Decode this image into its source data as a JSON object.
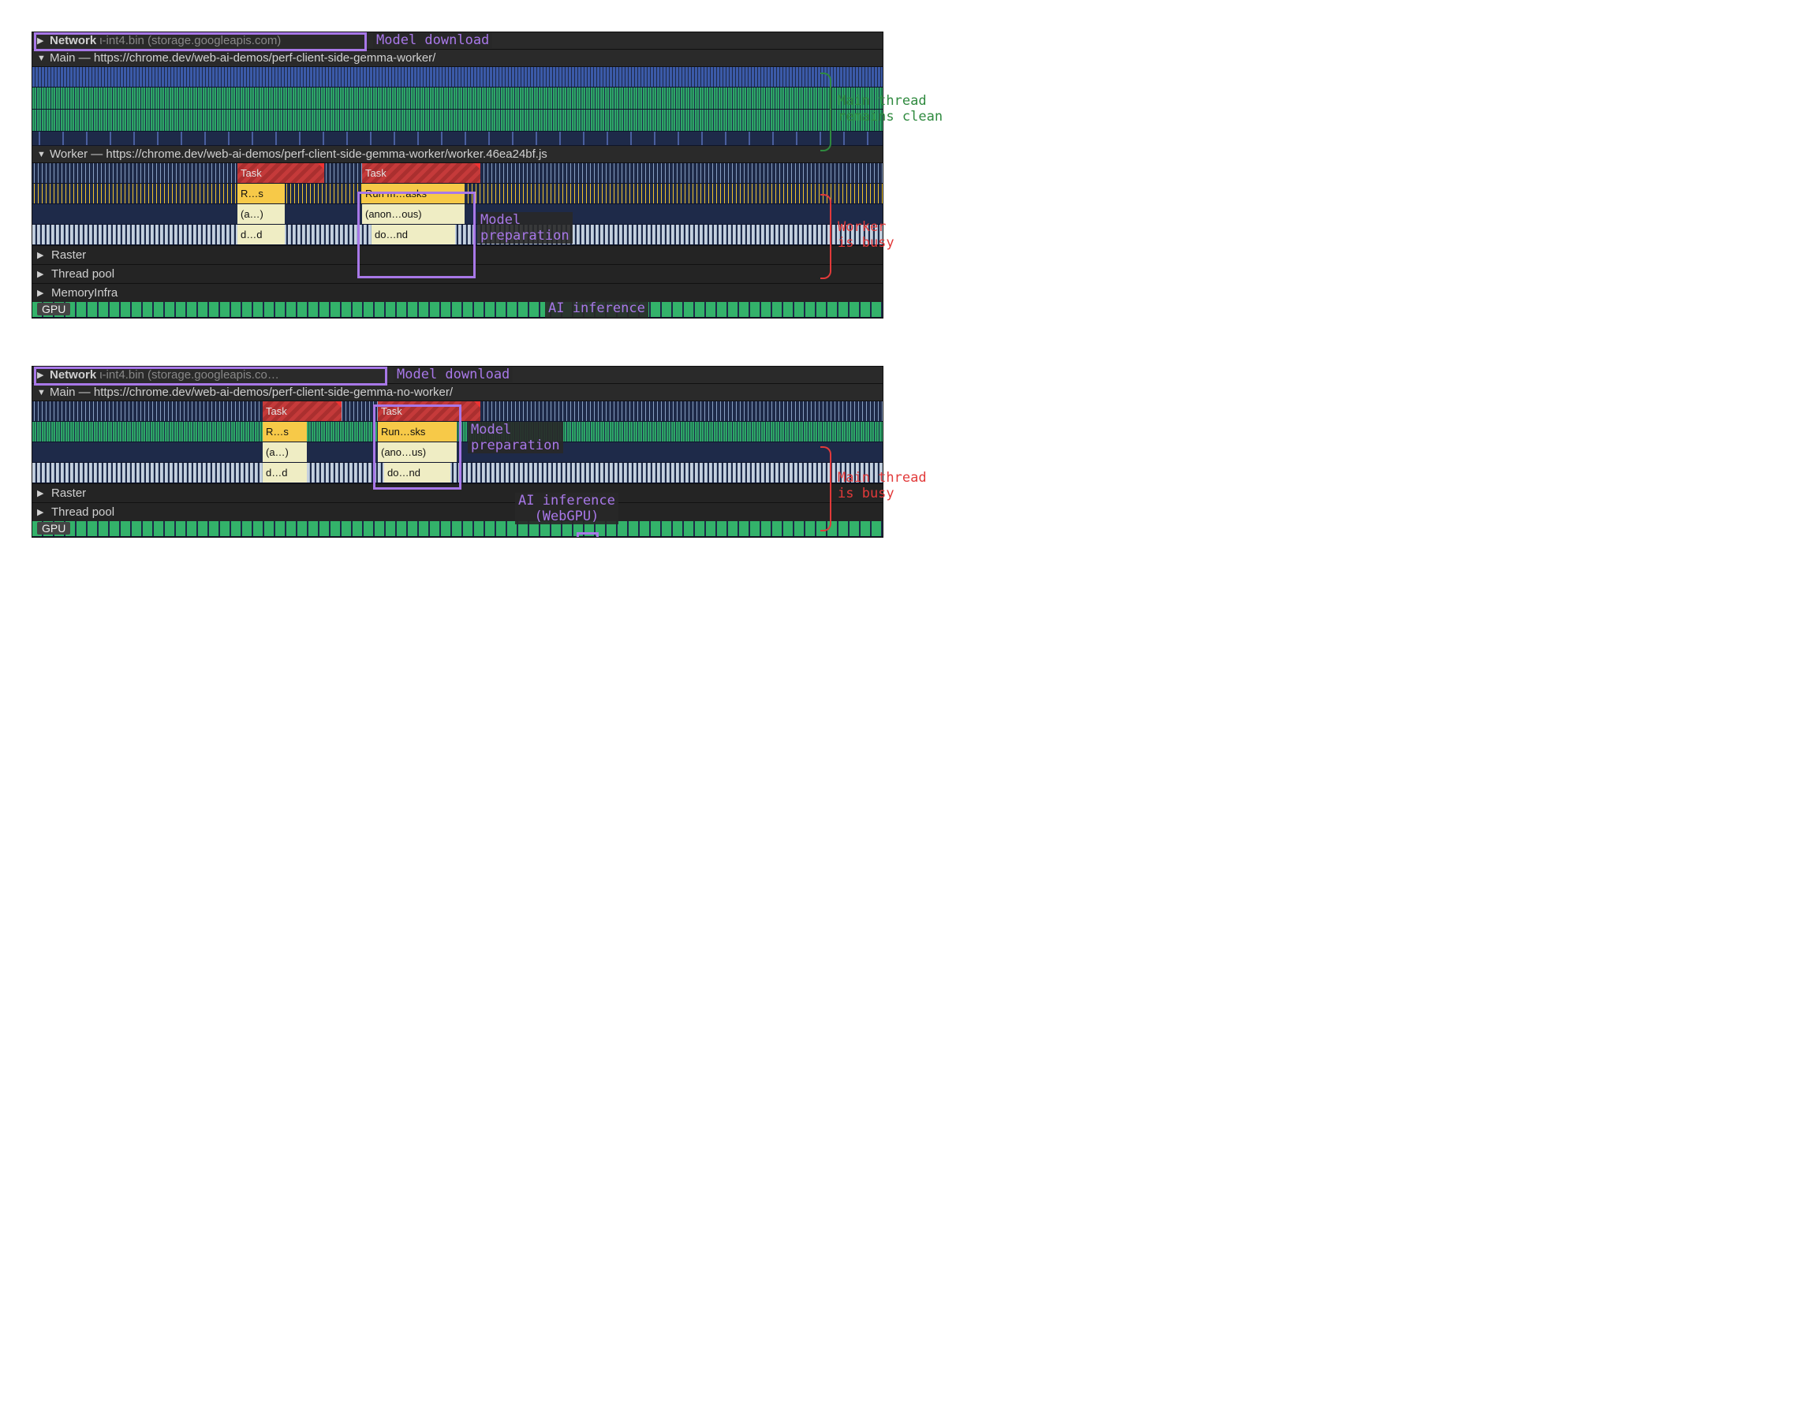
{
  "common_labels": {
    "model_download": "Model download",
    "model_prep": "Model\npreparation",
    "ai_inference": "AI inference\n(WebGPU)",
    "raster": "Raster",
    "thread_pool": "Thread pool",
    "memory_infra": "MemoryInfra",
    "gpu": "GPU"
  },
  "blocks": {
    "task": "Task",
    "rs": "R…s",
    "a": "(a…)",
    "dd": "d…d",
    "run_masks": "Run m…asks",
    "run_sks": "Run…sks",
    "anon_ous": "(anon…ous)",
    "ano_us": "(ano…us)",
    "do_nd": "do…nd"
  },
  "panel1": {
    "network_header": "Network",
    "network_file": "ι-int4.bin (storage.googleapis.com)",
    "main_header": "Main — https://chrome.dev/web-ai-demos/perf-client-side-gemma-worker/",
    "worker_header": "Worker — https://chrome.dev/web-ai-demos/perf-client-side-gemma-worker/worker.46ea24bf.js",
    "side1": "Main thread\nremains clean",
    "side2": "Worker\nis busy"
  },
  "panel2": {
    "network_header": "Network",
    "network_file": "ι-int4.bin (storage.googleapis.co…",
    "main_header": "Main — https://chrome.dev/web-ai-demos/perf-client-side-gemma-no-worker/",
    "side1": "Main thread\nis busy"
  }
}
